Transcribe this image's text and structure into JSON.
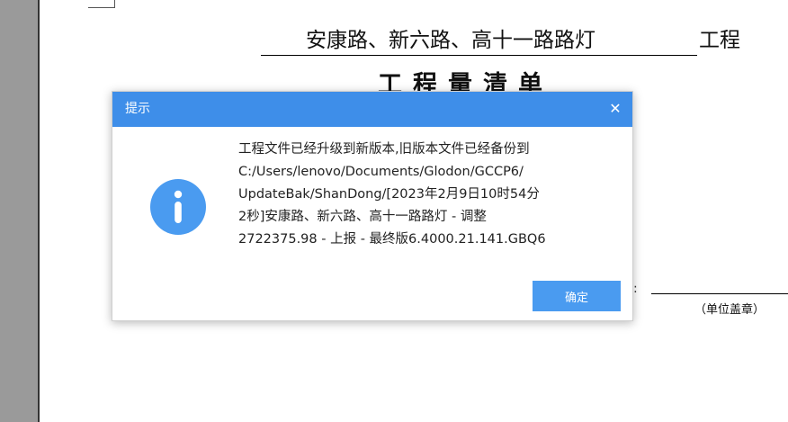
{
  "document": {
    "project_name": "安康路、新六路、高十一路路灯",
    "project_suffix": "工程",
    "heading": "工程量清单",
    "signature_colon": ":",
    "unit_stamp_label": "（单位盖章）"
  },
  "dialog": {
    "title": "提示",
    "close_glyph": "✕",
    "message_lines": [
      "工程文件已经升级到新版本,旧版本文件已经备份到",
      "C:/Users/lenovo/Documents/Glodon/GCCP6/",
      "UpdateBak/ShanDong/[2023年2月9日10时54分",
      "2秒]安康路、新六路、高十一路路灯 - 调整",
      "2722375.98 - 上报 - 最终版6.4000.21.141.GBQ6"
    ],
    "ok_label": "确定",
    "icon": "info-icon"
  },
  "colors": {
    "accent": "#3e8ee9",
    "button": "#4a9bf0",
    "icon": "#4a9bf0"
  }
}
